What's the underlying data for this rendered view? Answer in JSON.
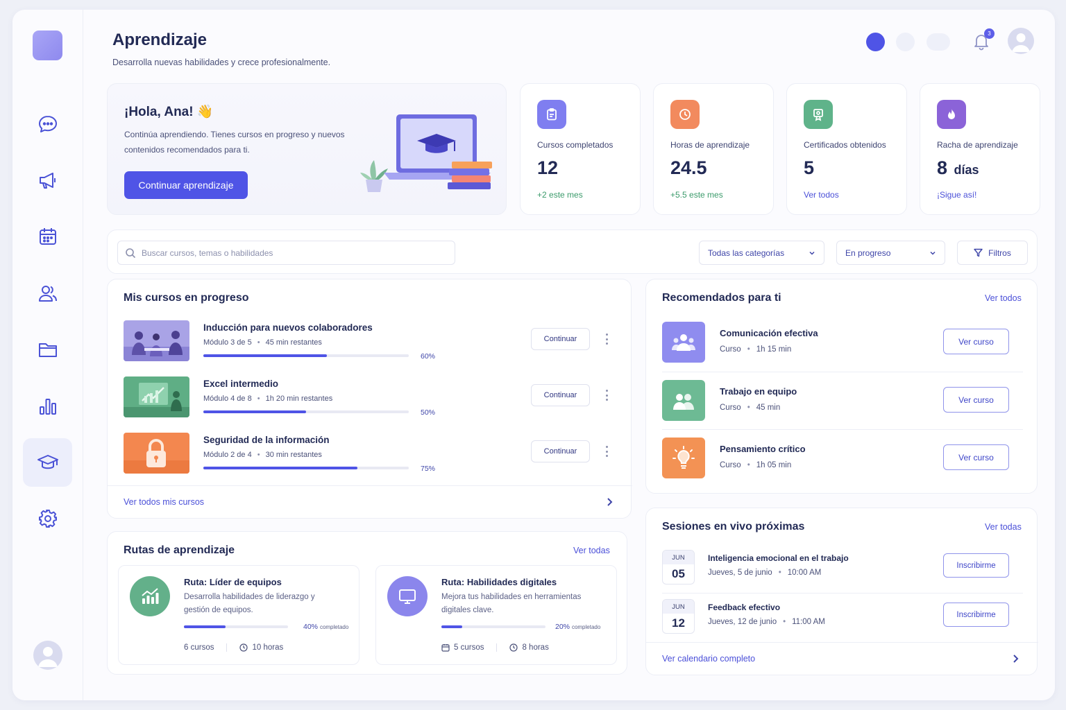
{
  "header": {
    "title": "Aprendizaje",
    "subtitle": "Desarrolla nuevas habilidades y crece profesionalmente.",
    "notification_count": "3"
  },
  "sidebar": {
    "items": [
      {
        "icon": "chat-icon"
      },
      {
        "icon": "megaphone-icon"
      },
      {
        "icon": "calendar-icon"
      },
      {
        "icon": "users-icon"
      },
      {
        "icon": "folder-icon"
      },
      {
        "icon": "bar-chart-icon"
      },
      {
        "icon": "graduation-cap-icon",
        "active": true
      },
      {
        "icon": "gear-icon"
      }
    ]
  },
  "hero": {
    "greeting": "¡Hola, Ana! 👋",
    "text": "Continúa aprendiendo. Tienes cursos en progreso y nuevos contenidos recomendados para ti.",
    "button": "Continuar aprendizaje"
  },
  "stats": [
    {
      "label": "Cursos completados",
      "value": "12",
      "unit": "",
      "foot": "+2 este mes",
      "foot_color": "#3a9a6a",
      "icon": "clipboard-icon",
      "color": "#7f7ef0"
    },
    {
      "label": "Horas de aprendizaje",
      "value": "24.5",
      "unit": "",
      "foot": "+5.5 este mes",
      "foot_color": "#3a9a6a",
      "icon": "clock-icon",
      "color": "#f28a5e"
    },
    {
      "label": "Certificados obtenidos",
      "value": "5",
      "unit": "",
      "foot": "Ver todos",
      "foot_color": "#4a4fd8",
      "icon": "certificate-icon",
      "color": "#5fb38a"
    },
    {
      "label": "Racha de aprendizaje",
      "value": "8",
      "unit": "días",
      "foot": "¡Sigue así!",
      "foot_color": "#4a4fd8",
      "icon": "flame-icon",
      "color": "#8b63d8"
    }
  ],
  "filters": {
    "search_placeholder": "Buscar cursos, temas o habilidades",
    "category": "Todas las categorías",
    "status": "En progreso",
    "filters_button": "Filtros"
  },
  "courses": {
    "title": "Mis cursos en progreso",
    "continue_label": "Continuar",
    "footer_link": "Ver todos mis cursos",
    "items": [
      {
        "title": "Inducción para nuevos colaboradores",
        "module": "Módulo 3 de 5",
        "remaining": "45 min restantes",
        "progress": 0.6,
        "pct": "60%",
        "thumb": "people-meeting"
      },
      {
        "title": "Excel intermedio",
        "module": "Módulo 4 de 8",
        "remaining": "1h 20 min restantes",
        "progress": 0.5,
        "pct": "50%",
        "thumb": "chart-presentation"
      },
      {
        "title": "Seguridad de la información",
        "module": "Módulo 2 de 4",
        "remaining": "30 min restantes",
        "progress": 0.75,
        "pct": "75%",
        "thumb": "lock"
      }
    ]
  },
  "recommended": {
    "title": "Recomendados para ti",
    "link": "Ver todos",
    "button": "Ver curso",
    "items": [
      {
        "title": "Comunicación efectiva",
        "type": "Curso",
        "duration": "1h 15 min",
        "color": "#8f8cef",
        "icon": "people-icon"
      },
      {
        "title": "Trabajo en equipo",
        "type": "Curso",
        "duration": "45 min",
        "color": "#6dba94",
        "icon": "team-icon"
      },
      {
        "title": "Pensamiento crítico",
        "type": "Curso",
        "duration": "1h 05 min",
        "color": "#f39254",
        "icon": "lightbulb-icon"
      }
    ]
  },
  "routes": {
    "title": "Rutas de aprendizaje",
    "link": "Ver todas",
    "items": [
      {
        "title": "Ruta: Líder de equipos",
        "desc": "Desarrolla habilidades de liderazgo y gestión de equipos.",
        "pct": "40%",
        "progress": 0.4,
        "completed": "completado",
        "courses": "6 cursos",
        "hours": "10 horas",
        "color": "#63b08a",
        "icon": "growth-chart-icon"
      },
      {
        "title": "Ruta: Habilidades digitales",
        "desc": "Mejora tus habilidades en herramientas digitales clave.",
        "pct": "20%",
        "progress": 0.2,
        "completed": "completado",
        "courses": "5 cursos",
        "hours": "8 horas",
        "color": "#8b86ec",
        "icon": "monitor-icon"
      }
    ]
  },
  "sessions": {
    "title": "Sesiones en vivo próximas",
    "link": "Ver todas",
    "button": "Inscribirme",
    "footer_link": "Ver calendario completo",
    "items": [
      {
        "month": "JUN",
        "day": "05",
        "title": "Inteligencia emocional en el trabajo",
        "date": "Jueves, 5 de junio",
        "time": "10:00 AM"
      },
      {
        "month": "JUN",
        "day": "12",
        "title": "Feedback efectivo",
        "date": "Jueves, 12 de junio",
        "time": "11:00 AM"
      }
    ]
  }
}
